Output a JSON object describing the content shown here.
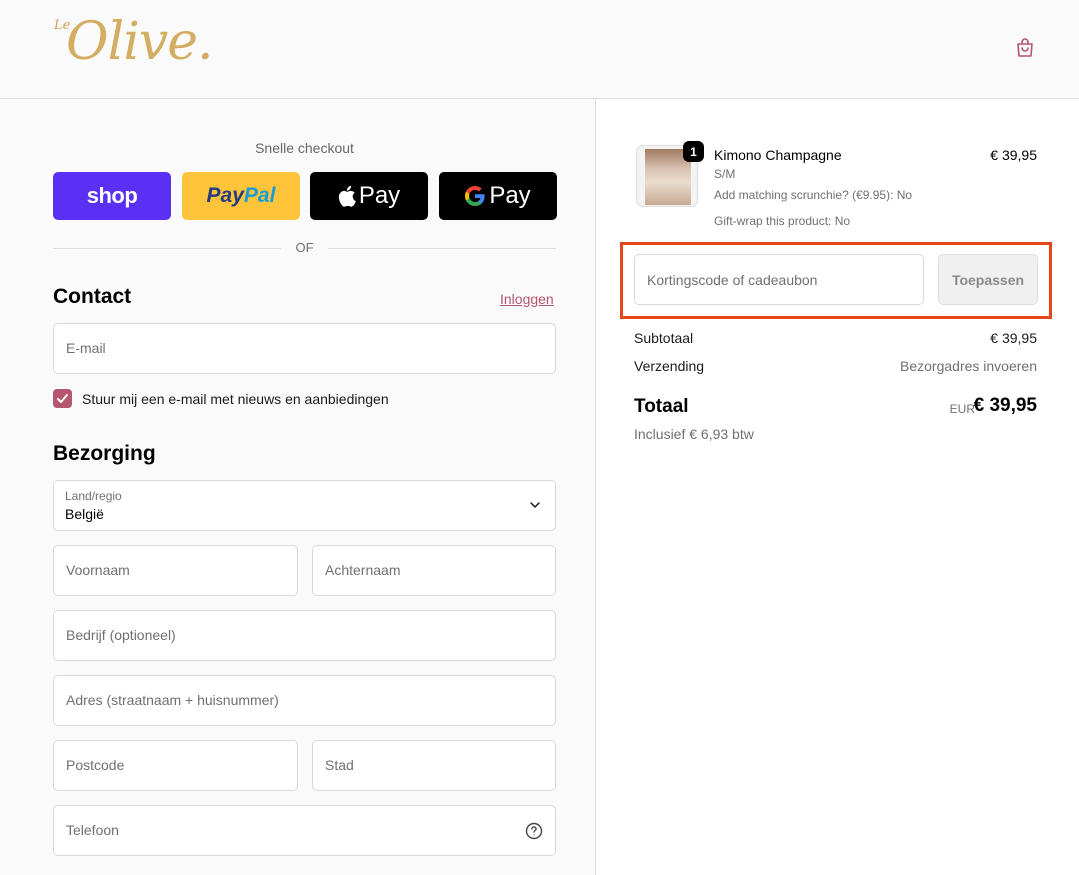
{
  "header": {
    "logo_small": "Le",
    "logo_main": "Olive."
  },
  "express": {
    "title": "Snelle checkout",
    "shop_label": "shop",
    "paypal_label_1": "Pay",
    "paypal_label_2": "Pal",
    "apple_label": "Pay",
    "google_label": "Pay",
    "or_label": "OF"
  },
  "contact": {
    "heading": "Contact",
    "login_link": "Inloggen",
    "email_placeholder": "E-mail",
    "newsletter_label": "Stuur mij een e-mail met nieuws en aanbiedingen",
    "newsletter_checked": true
  },
  "delivery": {
    "heading": "Bezorging",
    "country_label": "Land/regio",
    "country_value": "België",
    "first_name": "Voornaam",
    "last_name": "Achternaam",
    "company": "Bedrijf (optioneel)",
    "address": "Adres (straatnaam + huisnummer)",
    "postcode": "Postcode",
    "city": "Stad",
    "phone": "Telefoon"
  },
  "order": {
    "item": {
      "quantity": "1",
      "name": "Kimono Champagne",
      "price": "€ 39,95",
      "variant": "S/M",
      "option_1": "Add matching scrunchie? (€9.95): No",
      "option_2": "Gift-wrap this product: No"
    },
    "discount_placeholder": "Kortingscode of cadeaubon",
    "apply_label": "Toepassen",
    "subtotal_label": "Subtotaal",
    "subtotal_value": "€ 39,95",
    "shipping_label": "Verzending",
    "shipping_value": "Bezorgadres invoeren",
    "total_label": "Totaal",
    "total_currency": "EUR",
    "total_value": "€ 39,95",
    "tax_line": "Inclusief € 6,93 btw"
  },
  "colors": {
    "accent": "#b4566e",
    "shop_purple": "#5a31f4",
    "paypal_yellow": "#ffc439",
    "highlight_border": "#e4471b"
  }
}
